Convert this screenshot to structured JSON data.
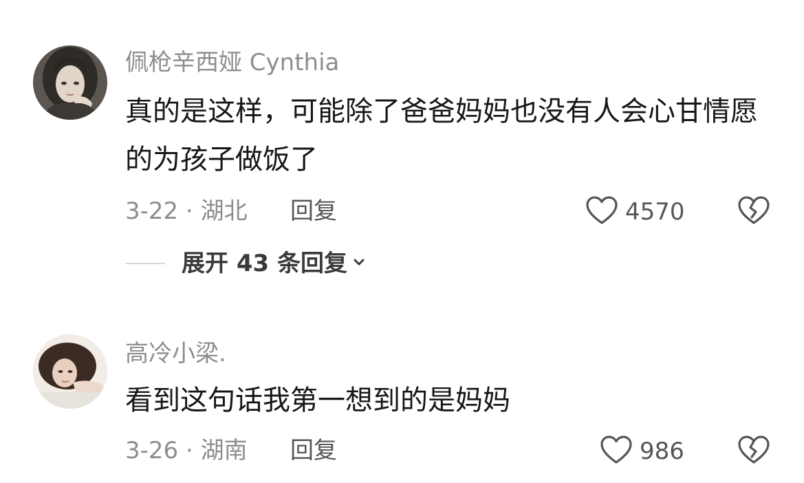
{
  "comments": [
    {
      "username": "佩枪辛西娅 Cynthia",
      "text": "真的是这样，可能除了爸爸妈妈也没有人会心甘情愿的为孩子做饭了",
      "date_location": "3-22 · 湖北",
      "reply_label": "回复",
      "like_count": "4570",
      "avatar_icon": "avatar-woman-dark-hair",
      "like_icon": "heart-outline-icon",
      "dislike_icon": "broken-heart-icon"
    },
    {
      "username": "高冷小梁.",
      "text": "看到这句话我第一想到的是妈妈",
      "date_location": "3-26 · 湖南",
      "reply_label": "回复",
      "like_count": "986",
      "avatar_icon": "avatar-woman-lying",
      "like_icon": "heart-outline-icon",
      "dislike_icon": "broken-heart-icon"
    }
  ],
  "expand_replies": {
    "label": "展开 43 条回复",
    "icon": "chevron-down-icon"
  },
  "colors": {
    "username": "#8d8d8d",
    "body_text": "#161616",
    "meta": "#8d8d8d",
    "action": "#555555",
    "divider": "#dadada"
  }
}
